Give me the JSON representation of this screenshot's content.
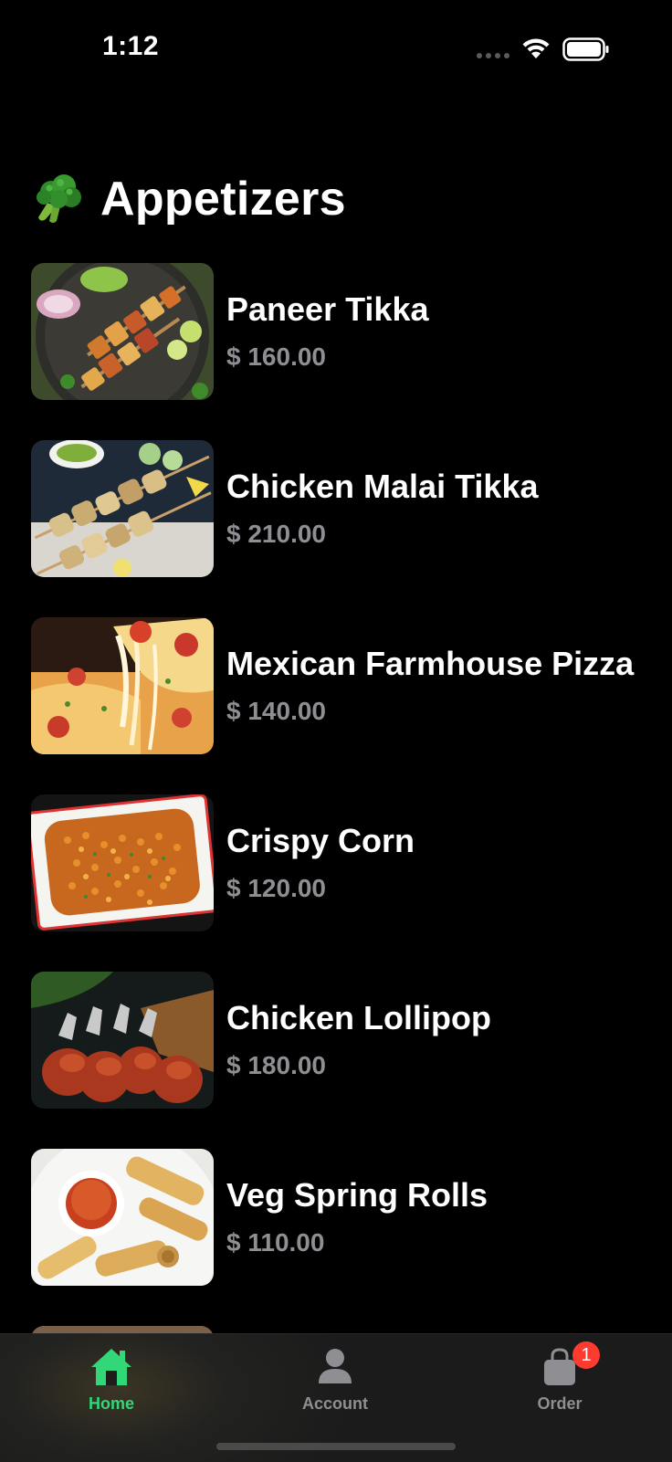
{
  "status_bar": {
    "time": "1:12"
  },
  "section": {
    "title": "Appetizers",
    "icon": "broccoli-icon"
  },
  "currency_symbol": "$",
  "menu_items": [
    {
      "name": "Paneer Tikka",
      "price": "$ 160.00",
      "image": "paneer-tikka-image"
    },
    {
      "name": "Chicken Malai Tikka",
      "price": "$ 210.00",
      "image": "chicken-malai-tikka-image"
    },
    {
      "name": "Mexican Farmhouse Pizza",
      "price": "$ 140.00",
      "image": "mexican-farmhouse-pizza-image"
    },
    {
      "name": "Crispy Corn",
      "price": "$ 120.00",
      "image": "crispy-corn-image"
    },
    {
      "name": "Chicken Lollipop",
      "price": "$ 180.00",
      "image": "chicken-lollipop-image"
    },
    {
      "name": "Veg Spring Rolls",
      "price": "$ 110.00",
      "image": "veg-spring-rolls-image"
    }
  ],
  "tab_bar": {
    "tabs": [
      {
        "label": "Home",
        "icon": "home-icon",
        "active": true
      },
      {
        "label": "Account",
        "icon": "person-icon",
        "active": false
      },
      {
        "label": "Order",
        "icon": "shopping-bag-icon",
        "active": false,
        "badge": "1"
      }
    ]
  },
  "colors": {
    "background": "#000000",
    "accent": "#32d778",
    "price_text": "#8e8e93",
    "badge": "#ff3b30"
  }
}
